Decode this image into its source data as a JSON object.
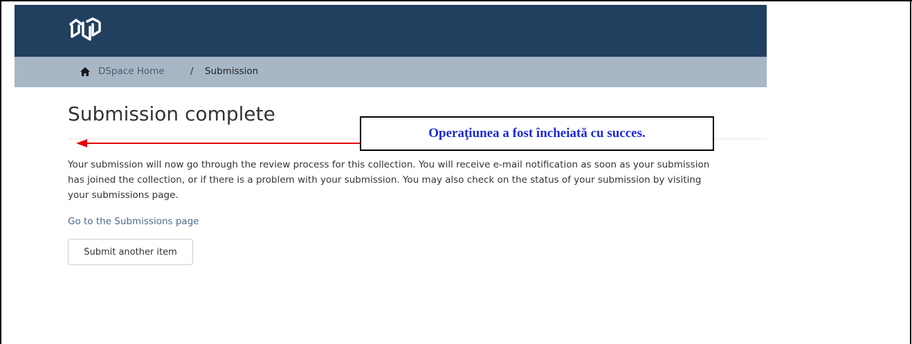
{
  "breadcrumb": {
    "home_label": "DSpace Home",
    "separator": "/",
    "current": "Submission"
  },
  "page": {
    "title": "Submission complete",
    "body": "Your submission will now go through the review process for this collection. You will receive e-mail notification as soon as your submission has joined the collection, or if there is a problem with your submission. You may also check on the status of your submission by visiting your submissions page.",
    "submissions_link": "Go to the Submissions page",
    "submit_another_label": "Submit another item"
  },
  "annotation": {
    "callout_text": "Operaţiunea a fost încheiată cu succes.",
    "arrow_color": "#e8000b",
    "text_color": "#1f2bd6"
  },
  "colors": {
    "header_bg": "#213f5e",
    "breadcrumb_bg": "#a7b7c6"
  },
  "icons": {
    "logo": "repository-logo",
    "home": "home-icon"
  }
}
